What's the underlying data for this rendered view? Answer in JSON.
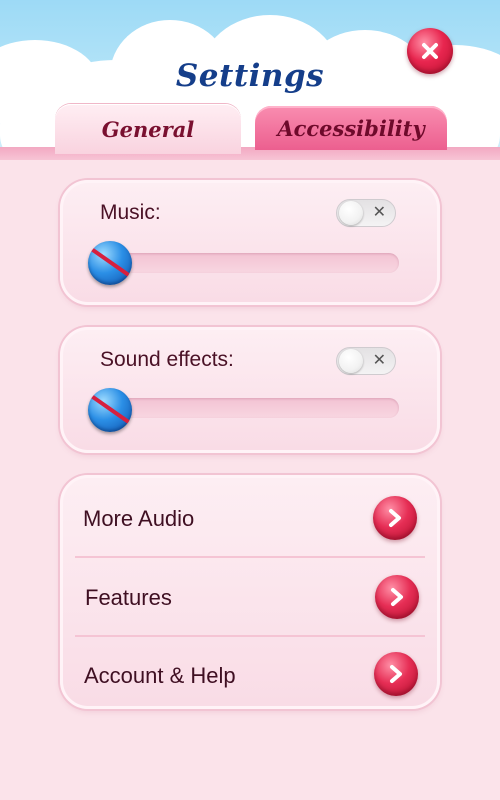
{
  "header": {
    "title": "Settings"
  },
  "tabs": [
    {
      "label": "General",
      "active": true
    },
    {
      "label": "Accessibility",
      "active": false
    }
  ],
  "audio": {
    "music": {
      "label": "Music:",
      "enabled": false,
      "volume": 0
    },
    "sound_effects": {
      "label": "Sound effects:",
      "enabled": false,
      "volume": 0
    }
  },
  "menu": {
    "items": [
      {
        "label": "More Audio",
        "icon": "chevron-right-icon"
      },
      {
        "label": "Features",
        "icon": "chevron-right-icon"
      },
      {
        "label": "Account & Help",
        "icon": "chevron-right-icon"
      }
    ]
  },
  "icons": {
    "close": "close-icon",
    "toggle_off": "x-icon",
    "slider_muted": "mute-slash-icon"
  },
  "colors": {
    "title": "#153e8a",
    "accent_red": "#e62e55",
    "slider_blue": "#2b8fe6",
    "tab_active": "#f9d3df",
    "tab_inactive": "#ec5f8f",
    "panel_background": "#fdeef3",
    "page_background": "#fbe3ea"
  }
}
